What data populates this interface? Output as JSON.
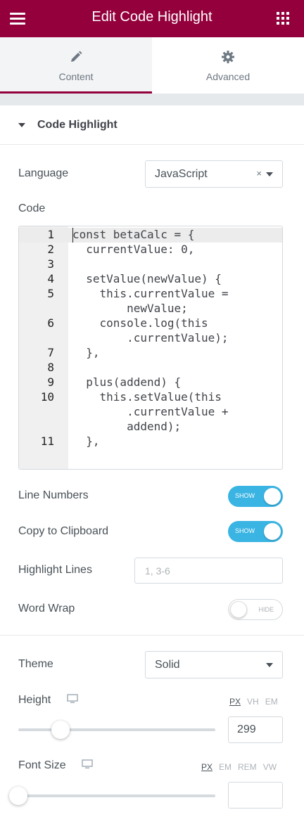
{
  "header": {
    "title": "Edit Code Highlight",
    "menu_icon": "hamburger-icon",
    "apps_icon": "grid-icon"
  },
  "tabs": [
    {
      "label": "Content",
      "icon": "pencil-icon",
      "active": true
    },
    {
      "label": "Advanced",
      "icon": "gear-icon",
      "active": false
    }
  ],
  "section": {
    "title": "Code Highlight"
  },
  "language": {
    "label": "Language",
    "value": "JavaScript",
    "clear": "×"
  },
  "code": {
    "label": "Code",
    "lines": [
      {
        "num": "1",
        "text": "const betaCalc = {"
      },
      {
        "num": "2",
        "text": "  currentValue: 0,"
      },
      {
        "num": "3",
        "text": ""
      },
      {
        "num": "4",
        "text": "  setValue(newValue) {"
      },
      {
        "num": "5",
        "text": "    this.currentValue ="
      },
      {
        "num": "",
        "text": "        newValue;"
      },
      {
        "num": "6",
        "text": "    console.log(this"
      },
      {
        "num": "",
        "text": "        .currentValue);"
      },
      {
        "num": "7",
        "text": "  },"
      },
      {
        "num": "8",
        "text": ""
      },
      {
        "num": "9",
        "text": "  plus(addend) {"
      },
      {
        "num": "10",
        "text": "    this.setValue(this"
      },
      {
        "num": "",
        "text": "        .currentValue +"
      },
      {
        "num": "",
        "text": "        addend);"
      },
      {
        "num": "11",
        "text": "  },"
      }
    ]
  },
  "line_numbers": {
    "label": "Line Numbers",
    "state": "SHOW"
  },
  "copy_clipboard": {
    "label": "Copy to Clipboard",
    "state": "SHOW"
  },
  "highlight_lines": {
    "label": "Highlight Lines",
    "placeholder": "1, 3-6"
  },
  "word_wrap": {
    "label": "Word Wrap",
    "state": "HIDE"
  },
  "theme": {
    "label": "Theme",
    "value": "Solid"
  },
  "height": {
    "label": "Height",
    "units": [
      "PX",
      "VH",
      "EM"
    ],
    "selected_unit": "PX",
    "value": "299",
    "slider_fraction": 0.214
  },
  "font_size": {
    "label": "Font Size",
    "units": [
      "PX",
      "EM",
      "REM",
      "VW"
    ],
    "selected_unit": "PX",
    "value": "",
    "slider_fraction": 0
  },
  "colors": {
    "brand": "#93003c",
    "toggle_on": "#39b4e3"
  }
}
